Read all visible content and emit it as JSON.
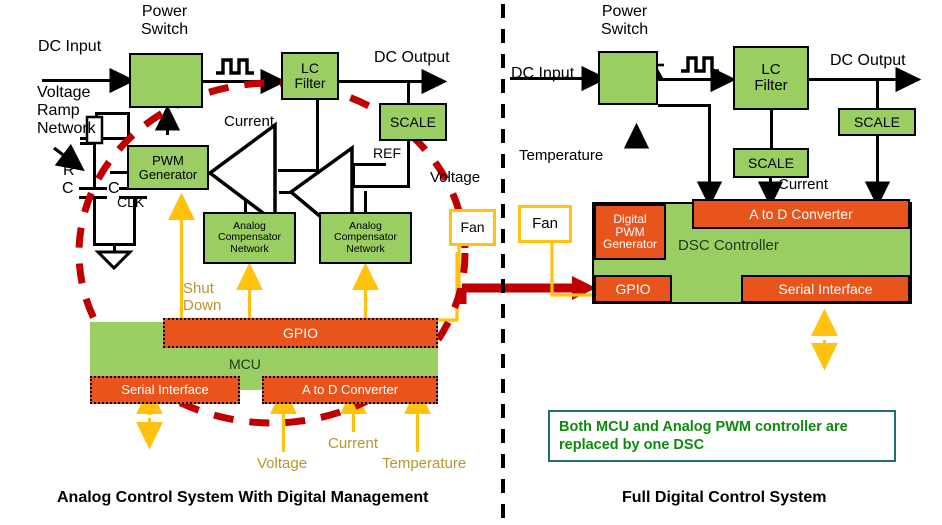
{
  "figure": {
    "left_caption": "Analog Control System With Digital Management",
    "right_caption": "Full Digital Control System",
    "note": "Both MCU and Analog PWM controller are replaced by one DSC"
  },
  "colors": {
    "green_block": "#9ACD62",
    "orange_block": "#E8541B",
    "gold": "#FFC20E",
    "gold_text": "#B8962E",
    "red_dash": "#C00000",
    "note_text": "#0E8A0E",
    "note_border": "#1F6E6E"
  },
  "left": {
    "title_power_switch": "Power\nSwitch",
    "label_dc_input": "DC Input",
    "label_dc_output": "DC Output",
    "label_voltage_ramp": "Voltage\nRamp\nNetwork",
    "label_r": "R",
    "label_c1": "C",
    "label_c2": "C",
    "label_clk": "CLK",
    "label_current_top": "Current",
    "label_ref": "REF",
    "label_voltage_right": "Voltage",
    "label_shutdown": "Shut\nDown",
    "label_voltage_bottom": "Voltage",
    "label_current_bottom": "Current",
    "label_temperature_bottom": "Temperature",
    "blocks": {
      "power_switch": "",
      "lc_filter": "LC\nFilter",
      "scale": "SCALE",
      "pwm_generator": "PWM\nGenerator",
      "analog_comp_1": "Analog\nCompensator\nNetwork",
      "analog_comp_2": "Analog\nCompensator\nNetwork",
      "fan": "Fan",
      "gpio": "GPIO",
      "mcu": "MCU",
      "serial_interface": "Serial Interface",
      "adc": "A to D Converter"
    }
  },
  "right": {
    "title_power_switch": "Power\nSwitch",
    "label_dc_input": "DC Input",
    "label_dc_output": "DC Output",
    "label_temperature": "Temperature",
    "label_current": "Current",
    "blocks": {
      "power_switch": "",
      "lc_filter": "LC\nFilter",
      "scale_out": "SCALE",
      "scale_current": "SCALE",
      "fan": "Fan",
      "digital_pwm_generator": "Digital\nPWM\nGenerator",
      "adc": "A to D Converter",
      "dsc_controller": "DSC Controller",
      "gpio": "GPIO",
      "serial_interface": "Serial Interface"
    }
  },
  "icons": {
    "mosfet": "mosfet-symbol",
    "pwm_wave": "square-wave-symbol",
    "ground": "ground-symbol",
    "opamp": "opamp-triangle",
    "divider": "vertical-dashed-divider",
    "highlight": "red-dashed-ellipse",
    "transition_arrow": "red-right-arrow"
  }
}
